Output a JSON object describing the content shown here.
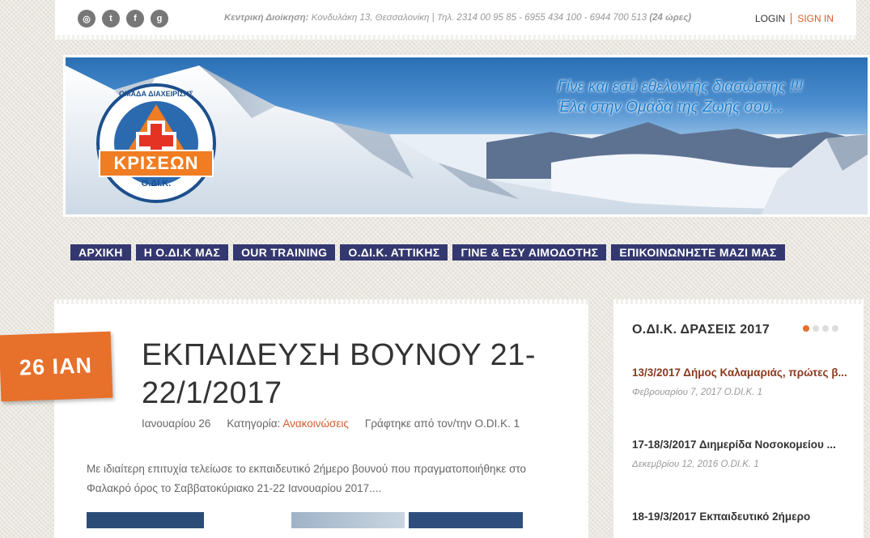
{
  "topbar": {
    "social": [
      {
        "icon": "rss-icon",
        "glyph": "◎"
      },
      {
        "icon": "twitter-icon",
        "glyph": "t"
      },
      {
        "icon": "facebook-icon",
        "glyph": "f"
      },
      {
        "icon": "google-icon",
        "glyph": "g"
      }
    ],
    "contact_label": "Κεντρική Διοίκηση:",
    "contact_text": " Κονδυλάκη 13, Θεσσαλονίκη | Τηλ. 2314 00 95 85 - 6955 434 100 - 6944 700 513 ",
    "contact_hours": "(24 ώρες)",
    "login": "LOGIN",
    "signin": "SIGN IN"
  },
  "banner": {
    "logo_top": "ΟΜΑΔΑ ΔΙΑΧΕΙΡΙΣΗΣ",
    "logo_main": "ΚΡΙΣΕΩΝ",
    "logo_sub": "Ο.ΔΙ.Κ.",
    "tagline_1": "Γίνε και εσύ εθελοντής διασώστης !!!",
    "tagline_2": "Έλα στην Ομάδα της Ζωής σου..."
  },
  "nav": [
    "ΑΡΧΙΚΗ",
    "Η Ο.ΔΙ.Κ ΜΑΣ",
    "OUR TRAINING",
    "Ο.ΔΙ.Κ. ΑΤΤΙΚΗΣ",
    "ΓΙΝΕ & ΕΣΥ ΑΙΜΟΔΟΤΗΣ",
    "ΕΠΙΚΟΙΝΩΝΗΣΤΕ ΜΑΖΙ ΜΑΣ"
  ],
  "post": {
    "date_badge": "26 ΙΑΝ",
    "title": "ΕΚΠΑΙΔΕΥΣΗ ΒΟΥΝΟΥ 21-22/1/2017",
    "date": "Ιανουαρίου 26",
    "category_label": "Κατηγορία:",
    "category": "Ανακοινώσεις",
    "author": "Γράφτηκε από τον/την O.DI.K. 1",
    "excerpt": "Με ιδιαίτερη επιτυχία τελείωσε το εκπαιδευτικό 2ήμερο βουνού που πραγματοποιήθηκε στο Φαλακρό όρος το Σαββατοκύριακο 21-22 Ιανουαρίου 2017...."
  },
  "sidebar": {
    "title": "Ο.ΔΙ.Κ. ΔΡΑΣΕΙΣ 2017",
    "items": [
      {
        "title": "13/3/2017 Δήμος Καλαμαριάς, πρώτες β...",
        "meta": "Φεβρουαρίου 7, 2017 O.DI.K. 1"
      },
      {
        "title": "17-18/3/2017 Διημερίδα Νοσοκομείου ...",
        "meta": "Δεκεμβρίου 12, 2016 O.DI.K. 1"
      },
      {
        "title": "18-19/3/2017 Εκπαιδευτικό 2ήμερο",
        "meta": ""
      }
    ]
  }
}
